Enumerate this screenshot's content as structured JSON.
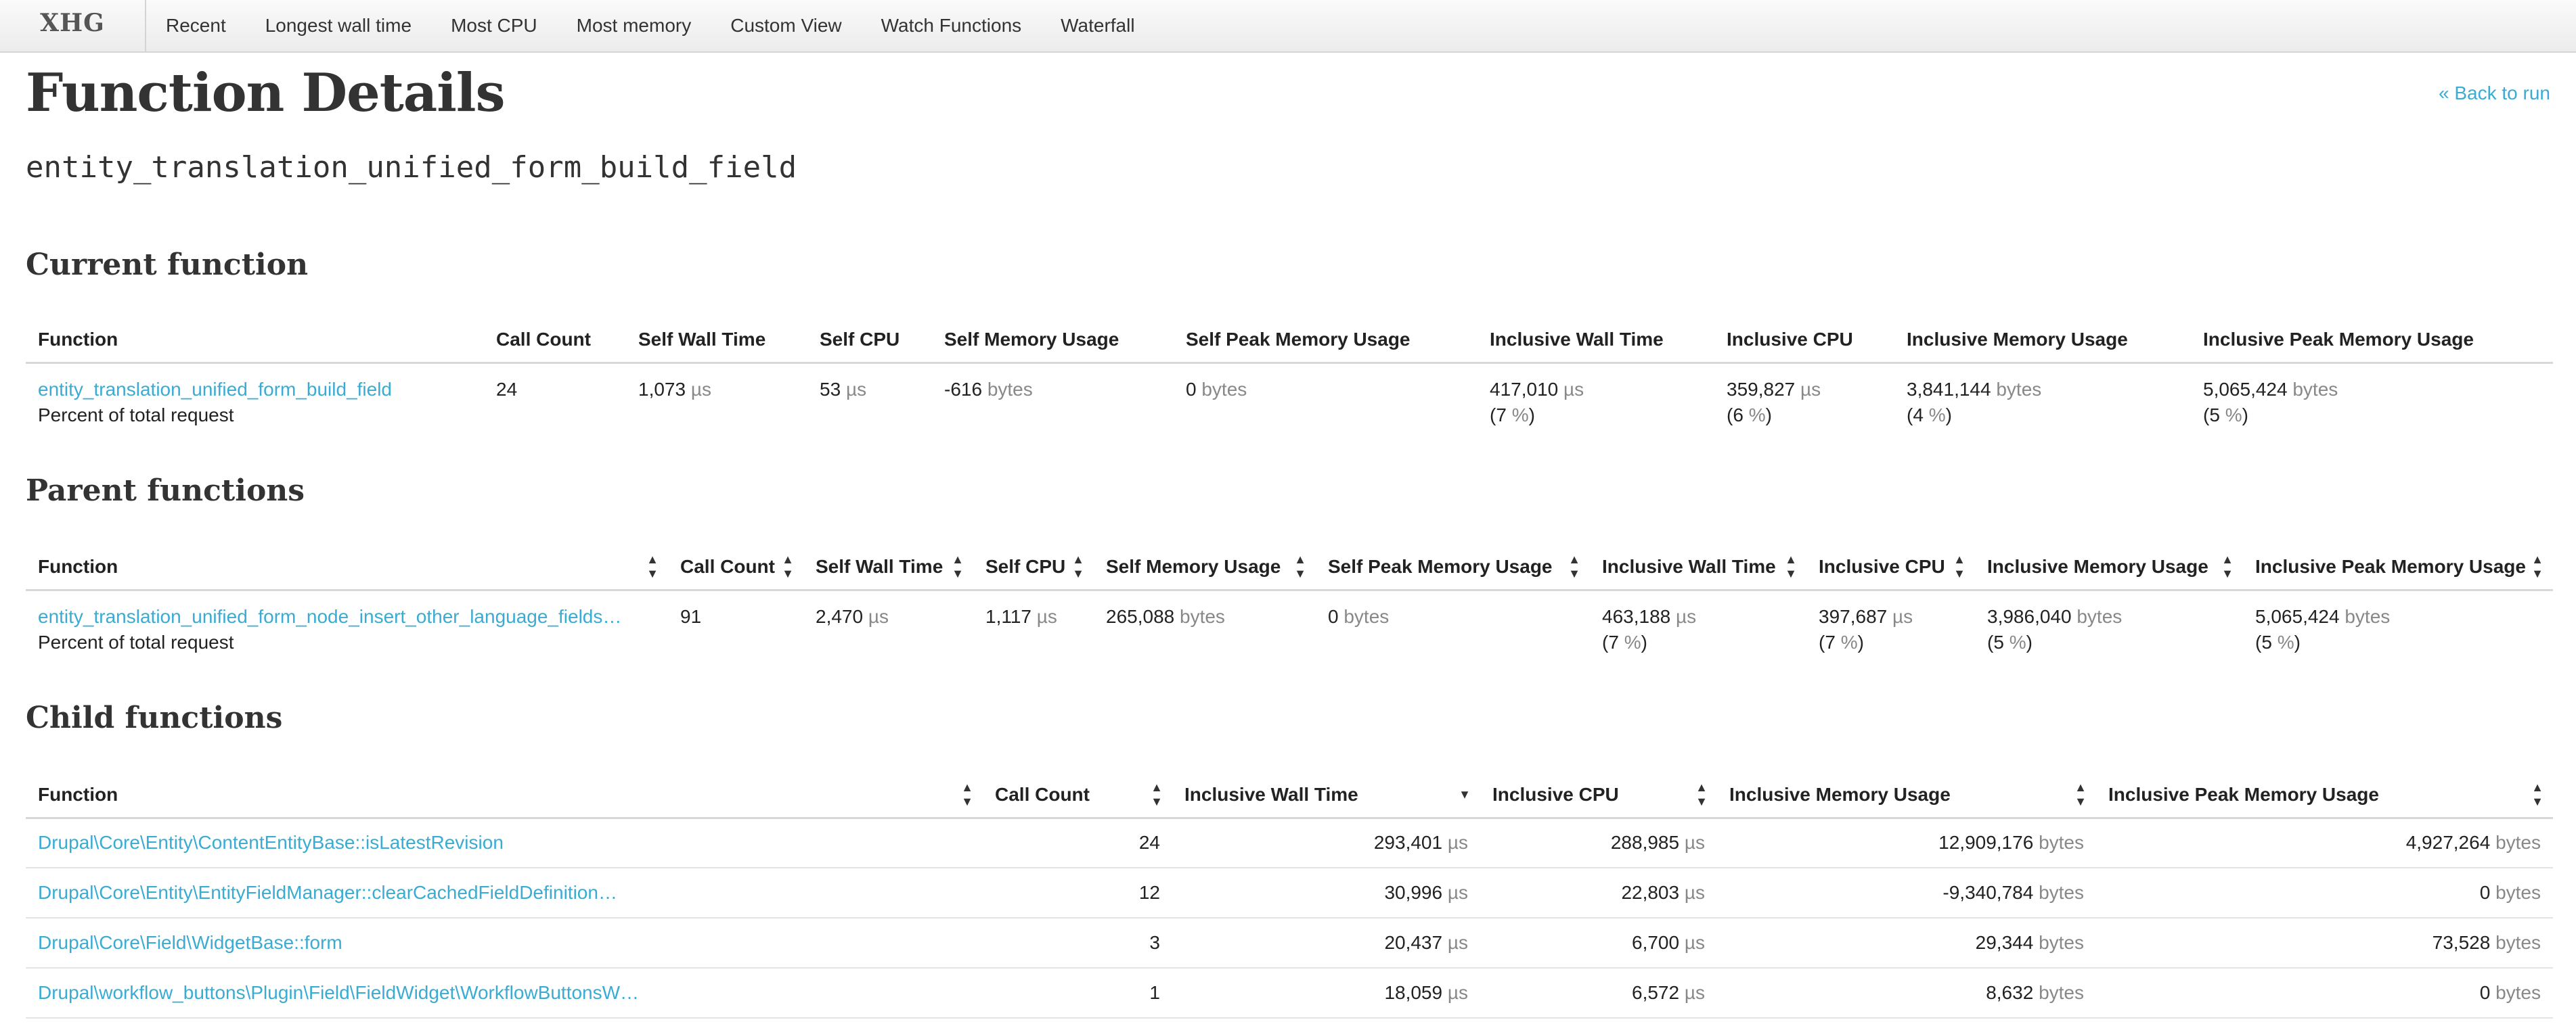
{
  "nav": {
    "brand": "XHG",
    "items": [
      "Recent",
      "Longest wall time",
      "Most CPU",
      "Most memory",
      "Custom View",
      "Watch Functions",
      "Waterfall"
    ]
  },
  "header": {
    "title": "Function Details",
    "back_link": "« Back to run",
    "function_name": "entity_translation_unified_form_build_field"
  },
  "current": {
    "title": "Current function",
    "headers": [
      "Function",
      "Call Count",
      "Self Wall Time",
      "Self CPU",
      "Self Memory Usage",
      "Self Peak Memory Usage",
      "Inclusive Wall Time",
      "Inclusive CPU",
      "Inclusive Memory Usage",
      "Inclusive Peak Memory Usage"
    ],
    "row": {
      "function": "entity_translation_unified_form_build_field",
      "percent_label": "Percent of total request",
      "call_count": "24",
      "self_wall": "1,073",
      "self_cpu": "53",
      "self_mem": "-616",
      "self_peak": "0",
      "incl_wall": "417,010",
      "incl_wall_pct": "7",
      "incl_cpu": "359,827",
      "incl_cpu_pct": "6",
      "incl_mem": "3,841,144",
      "incl_mem_pct": "4",
      "incl_peak": "5,065,424",
      "incl_peak_pct": "5"
    }
  },
  "parents": {
    "title": "Parent functions",
    "headers": [
      "Function",
      "Call Count",
      "Self Wall Time",
      "Self CPU",
      "Self Memory Usage",
      "Self Peak Memory Usage",
      "Inclusive Wall Time",
      "Inclusive CPU",
      "Inclusive Memory Usage",
      "Inclusive Peak Memory Usage"
    ],
    "row": {
      "function": "entity_translation_unified_form_node_insert_other_language_fields…",
      "percent_label": "Percent of total request",
      "call_count": "91",
      "self_wall": "2,470",
      "self_cpu": "1,117",
      "self_mem": "265,088",
      "self_peak": "0",
      "incl_wall": "463,188",
      "incl_wall_pct": "7",
      "incl_cpu": "397,687",
      "incl_cpu_pct": "7",
      "incl_mem": "3,986,040",
      "incl_mem_pct": "5",
      "incl_peak": "5,065,424",
      "incl_peak_pct": "5"
    }
  },
  "children": {
    "title": "Child functions",
    "headers": [
      "Function",
      "Call Count",
      "Inclusive Wall Time",
      "Inclusive CPU",
      "Inclusive Memory Usage",
      "Inclusive Peak Memory Usage"
    ],
    "rows": [
      {
        "function": "Drupal\\Core\\Entity\\ContentEntityBase::isLatestRevision",
        "call_count": "24",
        "incl_wall": "293,401",
        "incl_cpu": "288,985",
        "incl_mem": "12,909,176",
        "incl_peak": "4,927,264"
      },
      {
        "function": "Drupal\\Core\\Entity\\EntityFieldManager::clearCachedFieldDefinition…",
        "call_count": "12",
        "incl_wall": "30,996",
        "incl_cpu": "22,803",
        "incl_mem": "-9,340,784",
        "incl_peak": "0"
      },
      {
        "function": "Drupal\\Core\\Field\\WidgetBase::form",
        "call_count": "3",
        "incl_wall": "20,437",
        "incl_cpu": "6,700",
        "incl_mem": "29,344",
        "incl_peak": "73,528"
      },
      {
        "function": "Drupal\\workflow_buttons\\Plugin\\Field\\FieldWidget\\WorkflowButtonsW…",
        "call_count": "1",
        "incl_wall": "18,059",
        "incl_cpu": "6,572",
        "incl_mem": "8,632",
        "incl_peak": "0"
      }
    ]
  },
  "units": {
    "time": "µs",
    "bytes": "bytes",
    "percent": "%"
  },
  "colors": {
    "link": "#3aabd2",
    "unit": "#888888"
  }
}
